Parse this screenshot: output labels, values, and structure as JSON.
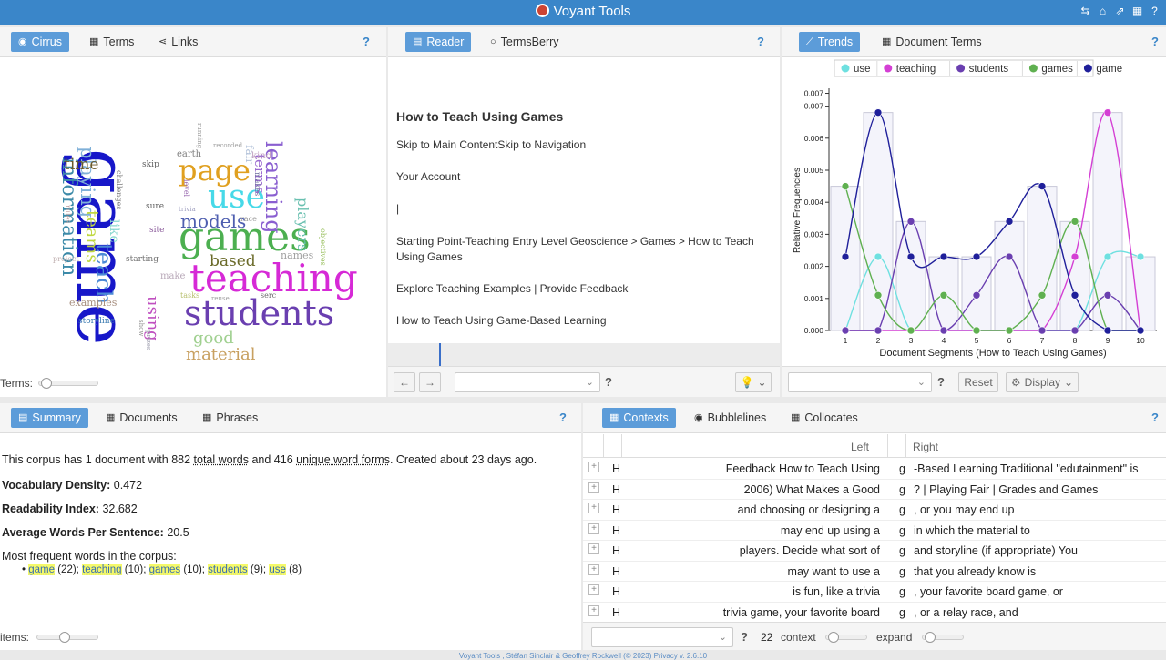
{
  "app": {
    "title": "Voyant Tools",
    "footer": "Voyant Tools , Stéfan Sinclair & Geoffrey Rockwell (© 2023) Privacy v. 2.6.10"
  },
  "cirrus": {
    "tabs": [
      {
        "label": "Cirrus"
      },
      {
        "label": "Terms"
      },
      {
        "label": "Links"
      }
    ],
    "help": "?",
    "terms_label": "Terms:",
    "words": [
      {
        "text": "game",
        "color": "#1717c9"
      },
      {
        "text": "games",
        "color": "#4caf50"
      },
      {
        "text": "teaching",
        "color": "#d629d6"
      },
      {
        "text": "students",
        "color": "#6a3fb0"
      },
      {
        "text": "use",
        "color": "#47d9e8"
      },
      {
        "text": "page",
        "color": "#e0a020"
      },
      {
        "text": "models",
        "color": "#4f5fb0"
      },
      {
        "text": "learning",
        "color": "#8a5fd0"
      },
      {
        "text": "information",
        "color": "#3c8aa8"
      },
      {
        "text": "playing",
        "color": "#7fb0d8"
      },
      {
        "text": "teams",
        "color": "#c0d840"
      },
      {
        "text": "teach",
        "color": "#4c8ad6"
      },
      {
        "text": "time",
        "color": "#6b5a2a"
      },
      {
        "text": "based",
        "color": "#6b6b2a"
      },
      {
        "text": "good",
        "color": "#a0d090"
      },
      {
        "text": "material",
        "color": "#c8a060"
      },
      {
        "text": "using",
        "color": "#c050c0"
      },
      {
        "text": "players",
        "color": "#6ac0b0"
      },
      {
        "text": "terms",
        "color": "#9a6ad0"
      },
      {
        "text": "like",
        "color": "#8ad8d0"
      },
      {
        "text": "fair",
        "color": "#b0c0d8"
      },
      {
        "text": "examples",
        "color": "#a89080"
      },
      {
        "text": "storyline",
        "color": "#3a7ab0"
      },
      {
        "text": "names",
        "color": "#a0a0a0"
      },
      {
        "text": "objectives",
        "color": "#9ac060"
      },
      {
        "text": "make",
        "color": "#b8a8b8"
      },
      {
        "text": "kind",
        "color": "#c0a0c0"
      },
      {
        "text": "makes",
        "color": "#7070a0"
      },
      {
        "text": "earth",
        "color": "#808080"
      },
      {
        "text": "skip",
        "color": "#606060"
      },
      {
        "text": "challenges",
        "color": "#7a7a7a"
      },
      {
        "text": "sure",
        "color": "#5a5a5a"
      },
      {
        "text": "site",
        "color": "#8a5a9a"
      },
      {
        "text": "starting",
        "color": "#707070"
      },
      {
        "text": "tasks",
        "color": "#b8c070"
      },
      {
        "text": "serc",
        "color": "#6a6a6a"
      },
      {
        "text": "race",
        "color": "#9a9a9a"
      },
      {
        "text": "level",
        "color": "#9a6ab0"
      },
      {
        "text": "recorded",
        "color": "#a0a0a0"
      },
      {
        "text": "running",
        "color": "#a0a0a0"
      },
      {
        "text": "rules",
        "color": "#c0a0a0"
      },
      {
        "text": "project",
        "color": "#c0b0b0"
      },
      {
        "text": "reuse",
        "color": "#a0a0a0"
      },
      {
        "text": "trivia",
        "color": "#a0a0c0"
      },
      {
        "text": "show",
        "color": "#909090"
      },
      {
        "text": "prizes",
        "color": "#a0a0b0"
      }
    ]
  },
  "reader": {
    "tabs": [
      {
        "label": "Reader"
      },
      {
        "label": "TermsBerry"
      }
    ],
    "help": "?",
    "title": "How to Teach Using Games",
    "paragraphs": [
      "Skip to Main ContentSkip to Navigation",
      "Your Account",
      "|",
      "Starting Point-Teaching Entry Level Geoscience > Games > How to Teach Using Games",
      "Explore Teaching Examples | Provide Feedback",
      "How to Teach Using Game-Based Learning"
    ],
    "footer_help": "?"
  },
  "trends": {
    "tabs": [
      {
        "label": "Trends"
      },
      {
        "label": "Document Terms"
      }
    ],
    "help": "?",
    "reset": "Reset",
    "display": "Display",
    "footer_help": "?"
  },
  "chart_data": {
    "type": "line",
    "xlabel": "Document Segments (How to Teach Using Games)",
    "ylabel": "Relative Frequencies",
    "x": [
      1,
      2,
      3,
      4,
      5,
      6,
      7,
      8,
      9,
      10
    ],
    "ylim": [
      0,
      0.0075
    ],
    "yticks": [
      0.0,
      0.001,
      0.002,
      0.003,
      0.004,
      0.005,
      0.006,
      0.007,
      0.007
    ],
    "legend_position": "top",
    "series": [
      {
        "name": "use",
        "color": "#6ee0e0",
        "values": [
          0,
          0.0023,
          0,
          0,
          0,
          0,
          0,
          0,
          0.0023,
          0.0023
        ]
      },
      {
        "name": "teaching",
        "color": "#d43fd4",
        "values": [
          0,
          0,
          0,
          0,
          0,
          0,
          0,
          0.0023,
          0.0068,
          0
        ]
      },
      {
        "name": "students",
        "color": "#6a3fb0",
        "values": [
          0,
          0,
          0.0034,
          0,
          0.0011,
          0.0023,
          0,
          0,
          0.0011,
          0
        ]
      },
      {
        "name": "games",
        "color": "#5fb050",
        "values": [
          0.0045,
          0.0011,
          0,
          0.0011,
          0,
          0,
          0.0011,
          0.0034,
          0,
          0
        ]
      },
      {
        "name": "game",
        "color": "#1f1f9a",
        "values": [
          0.0023,
          0.0068,
          0.0023,
          0.0023,
          0.0023,
          0.0034,
          0.0045,
          0.0011,
          0,
          0
        ]
      }
    ]
  },
  "summary": {
    "tabs": [
      {
        "label": "Summary"
      },
      {
        "label": "Documents"
      },
      {
        "label": "Phrases"
      }
    ],
    "help": "?",
    "intro_pre": "This corpus has 1 document with 882 ",
    "total_words": "total words",
    "intro_mid": " and 416 ",
    "unique_forms": "unique word forms",
    "intro_post": ". Created about 23 days ago.",
    "density_label": "Vocabulary Density:",
    "density_value": "0.472",
    "readability_label": "Readability Index:",
    "readability_value": "32.682",
    "avg_label": "Average Words Per Sentence:",
    "avg_value": "20.5",
    "frequent_label": "Most frequent words in the corpus:",
    "frequent": [
      {
        "word": "game",
        "count": "(22)"
      },
      {
        "word": "teaching",
        "count": "(10)"
      },
      {
        "word": "games",
        "count": "(10)"
      },
      {
        "word": "students",
        "count": "(9)"
      },
      {
        "word": "use",
        "count": "(8)"
      }
    ],
    "items_label": "items:"
  },
  "contexts": {
    "tabs": [
      {
        "label": "Contexts"
      },
      {
        "label": "Bubblelines"
      },
      {
        "label": "Collocates"
      }
    ],
    "help": "?",
    "col_left": "Left",
    "col_right": "Right",
    "rows": [
      {
        "doc": "H",
        "left": "Feedback How to Teach Using",
        "term": "g",
        "right": "-Based Learning Traditional \"edutainment\" is"
      },
      {
        "doc": "H",
        "left": "2006) What Makes a Good",
        "term": "g",
        "right": "? | Playing Fair | Grades and Games"
      },
      {
        "doc": "H",
        "left": "and choosing or designing a",
        "term": "g",
        "right": ", or you may end up"
      },
      {
        "doc": "H",
        "left": "may end up using a",
        "term": "g",
        "right": "in which the material to"
      },
      {
        "doc": "H",
        "left": "players. Decide what sort of",
        "term": "g",
        "right": "and storyline (if appropriate) You"
      },
      {
        "doc": "H",
        "left": "may want to use a",
        "term": "g",
        "right": "that you already know is"
      },
      {
        "doc": "H",
        "left": "is fun, like a trivia",
        "term": "g",
        "right": ", your favorite board game, or"
      },
      {
        "doc": "H",
        "left": "trivia game, your favorite board",
        "term": "g",
        "right": ", or a relay race, and"
      }
    ],
    "footer_help": "?",
    "context_value": "22",
    "context_label": "context",
    "expand_label": "expand"
  }
}
